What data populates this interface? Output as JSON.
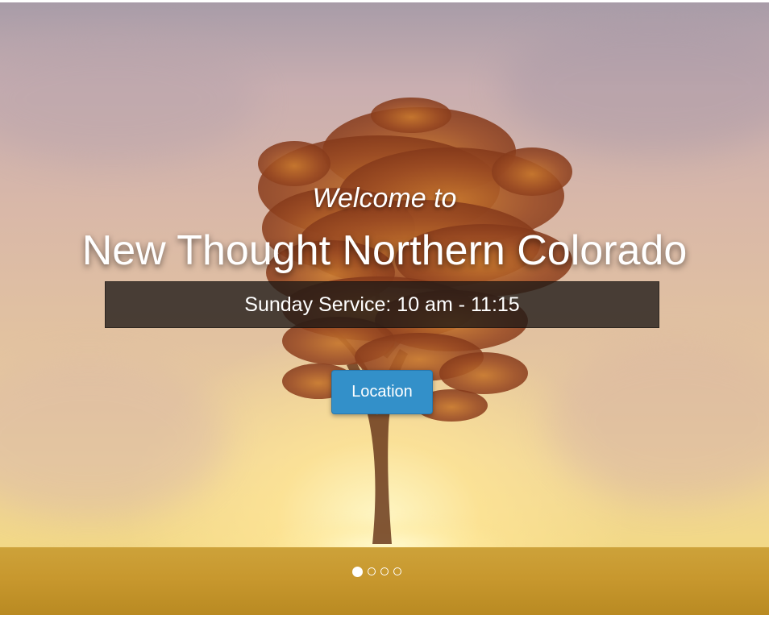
{
  "hero": {
    "welcome_text": "Welcome to",
    "title": "New Thought Northern Colorado",
    "service_text": "Sunday Service: 10 am - 11:15",
    "location_button_label": "Location",
    "background_image": "sunset-tree-image"
  },
  "carousel": {
    "slide_count": 4,
    "active_index": 0
  },
  "colors": {
    "button": "#3390c9",
    "service_bar": "#1e1816",
    "text": "#ffffff"
  }
}
